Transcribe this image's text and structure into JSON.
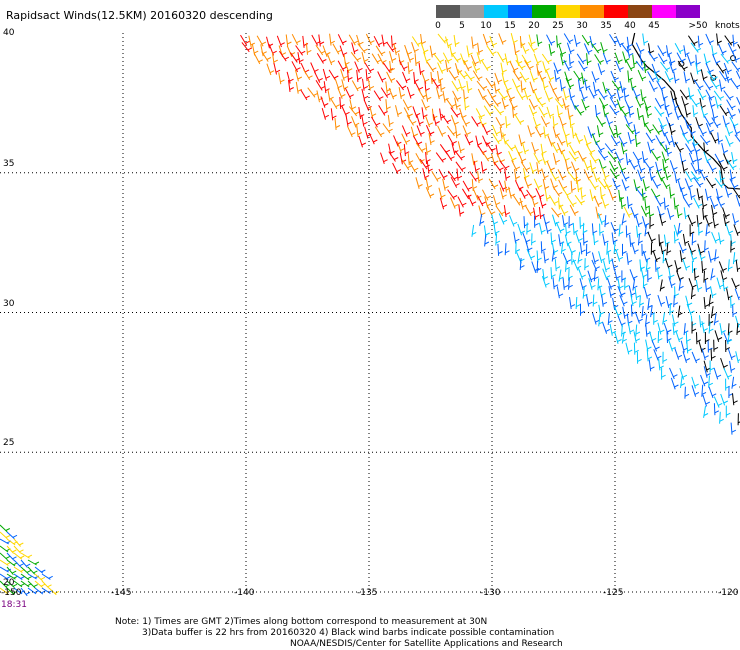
{
  "title": "Rapidsact Winds(12.5KM) 20160320 descending",
  "legend": {
    "unit": "knots",
    "bins": [
      {
        "label": "0",
        "color": "#5a5a5a"
      },
      {
        "label": "5",
        "color": "#9e9e9e"
      },
      {
        "label": "10",
        "color": "#00c8ff"
      },
      {
        "label": "15",
        "color": "#0064ff"
      },
      {
        "label": "20",
        "color": "#00aa00"
      },
      {
        "label": "25",
        "color": "#ffd700"
      },
      {
        "label": "30",
        "color": "#ff8c00"
      },
      {
        "label": "35",
        "color": "#ff0000"
      },
      {
        "label": "40",
        "color": "#8b4513"
      },
      {
        "label": "45",
        "color": "#ff00ff"
      },
      {
        "label": ">50",
        "color": "#8a00c8"
      }
    ],
    "tick_labels": [
      "0",
      "5",
      "10",
      "15",
      "20",
      "25",
      "30",
      "35",
      "40",
      "45",
      ">50"
    ]
  },
  "axes": {
    "x_ticks": [
      "-150",
      "-145",
      "-140",
      "-135",
      "-130",
      "-125",
      "-120"
    ],
    "y_ticks": [
      "40",
      "35",
      "30",
      "25",
      "20"
    ]
  },
  "time_label": "18:31",
  "notes": [
    "Note: 1) Times are GMT 2)Times along bottom correspond to measurement at 30N",
    "3)Data buffer is 22 hrs from 20160320 4) Black wind barbs indicate possible contamination",
    "NOAA/NESDIS/Center for Satellite Applications and Research"
  ]
}
